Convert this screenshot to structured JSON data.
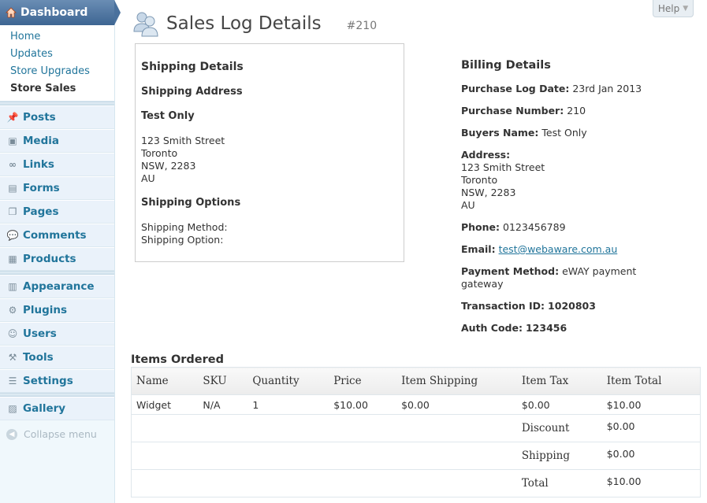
{
  "sidebar": {
    "dashboard_label": "Dashboard",
    "submenu": [
      "Home",
      "Updates",
      "Store Upgrades",
      "Store Sales"
    ],
    "group1": [
      {
        "label": "Posts",
        "icon": "pushpin-icon"
      },
      {
        "label": "Media",
        "icon": "media-icon"
      },
      {
        "label": "Links",
        "icon": "link-icon"
      },
      {
        "label": "Forms",
        "icon": "form-icon"
      },
      {
        "label": "Pages",
        "icon": "pages-icon"
      },
      {
        "label": "Comments",
        "icon": "comment-icon"
      },
      {
        "label": "Products",
        "icon": "product-icon"
      }
    ],
    "group2": [
      {
        "label": "Appearance",
        "icon": "appearance-icon"
      },
      {
        "label": "Plugins",
        "icon": "plugin-icon"
      },
      {
        "label": "Users",
        "icon": "users-icon"
      },
      {
        "label": "Tools",
        "icon": "tools-icon"
      },
      {
        "label": "Settings",
        "icon": "settings-icon"
      }
    ],
    "group3": [
      {
        "label": "Gallery",
        "icon": "gallery-icon"
      }
    ],
    "collapse_label": "Collapse menu"
  },
  "header": {
    "help_label": "Help",
    "title": "Sales Log Details",
    "log_id": "#210"
  },
  "shipping": {
    "heading": "Shipping Details",
    "address_heading": "Shipping Address",
    "name": "Test Only",
    "address_lines": [
      "123 Smith Street",
      "Toronto",
      "NSW, 2283",
      "AU"
    ],
    "options_heading": "Shipping Options",
    "method_label": "Shipping Method:",
    "option_label": "Shipping Option:"
  },
  "billing": {
    "heading": "Billing Details",
    "purchase_date_label": "Purchase Log Date:",
    "purchase_date": "23rd Jan 2013",
    "purchase_number_label": "Purchase Number:",
    "purchase_number": "210",
    "buyer_label": "Buyers Name:",
    "buyer": "Test Only",
    "address_label": "Address:",
    "address_lines": [
      "123 Smith Street",
      "Toronto",
      "NSW, 2283",
      "AU"
    ],
    "phone_label": "Phone:",
    "phone": "0123456789",
    "email_label": "Email:",
    "email": "test@webaware.com.au",
    "payment_label": "Payment Method:",
    "payment": "eWAY payment gateway",
    "transaction_label": "Transaction ID:",
    "transaction": "1020803",
    "auth_label": "Auth Code:",
    "auth": "123456"
  },
  "items": {
    "heading": "Items Ordered",
    "columns": [
      "Name",
      "SKU",
      "Quantity",
      "Price",
      "Item Shipping",
      "Item Tax",
      "Item Total"
    ],
    "rows": [
      [
        "Widget",
        "N/A",
        "1",
        "$10.00",
        "$0.00",
        "$0.00",
        "$10.00"
      ]
    ],
    "summary": [
      {
        "label": "Discount",
        "value": "$0.00"
      },
      {
        "label": "Shipping",
        "value": "$0.00"
      },
      {
        "label": "Total",
        "value": "$10.00"
      }
    ]
  }
}
